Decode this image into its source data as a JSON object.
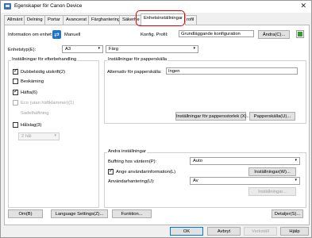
{
  "window": {
    "title": "Egenskaper för Canon Device",
    "close_glyph": "✕"
  },
  "tabs": [
    {
      "label": "Allmänt"
    },
    {
      "label": "Delning"
    },
    {
      "label": "Portar"
    },
    {
      "label": "Avancerat"
    },
    {
      "label": "Färghantering"
    },
    {
      "label": "Säkerhe"
    },
    {
      "label": "Enhetsinställningar"
    },
    {
      "label": "rofil"
    }
  ],
  "header": {
    "info_label": "Information om enhet:",
    "mode_value": "Manuell",
    "config_label": "Konfig. Profil:",
    "config_value": "Grundläggande konfiguration",
    "change_button": "Ändra(C)..."
  },
  "device_type": {
    "label": "Enhetstyp(E):",
    "value": "A3",
    "color_value": "Färg"
  },
  "finishing": {
    "title": "Inställningar för efterbehandling",
    "duplex": {
      "label": "Dubbelsidig utskrift(2)",
      "checked": true
    },
    "trimming": {
      "label": "Beskärning",
      "checked": false
    },
    "fold": {
      "label": "Häfta(6)",
      "checked": true
    },
    "booklet": {
      "label": "Eco (utan häftklammer)(1)",
      "checked": false
    },
    "saddle": {
      "label": "Sadelhäftning"
    },
    "punch": {
      "label": "Hålslag(3)",
      "checked": false
    },
    "punch_value": "2 hål"
  },
  "paper_source": {
    "title": "Inställningar för papperskälla",
    "alt_label": "Alternativ för papperskälla:",
    "alt_value": "Ingen",
    "size_button": "Inställningar för pappersstorlek (X)...",
    "source_button": "Papperskälla(U)..."
  },
  "other": {
    "title": "Andra inställningar",
    "buffer_label": "Buffring hos väntern(P):",
    "buffer_value": "Auto",
    "user_info": {
      "label": "Ange användarinformation(L)",
      "checked": true
    },
    "settings_button": "Inställningar(W)...",
    "user_mgmt_label": "Användarhantering(U):",
    "user_mgmt_value": "Av",
    "user_mgmt_button": "Inställningar..."
  },
  "bottom_buttons": {
    "about": "Om(B)",
    "language": "Language Settings(Z)...",
    "function": "Funktion...",
    "details": "Detaljer(S)..."
  },
  "dialog_buttons": {
    "ok": "OK",
    "cancel": "Avbryt",
    "apply": "Verkställ",
    "help": "Hjälp"
  },
  "icons": {
    "refresh": "⇄",
    "dropdown": "▾"
  }
}
